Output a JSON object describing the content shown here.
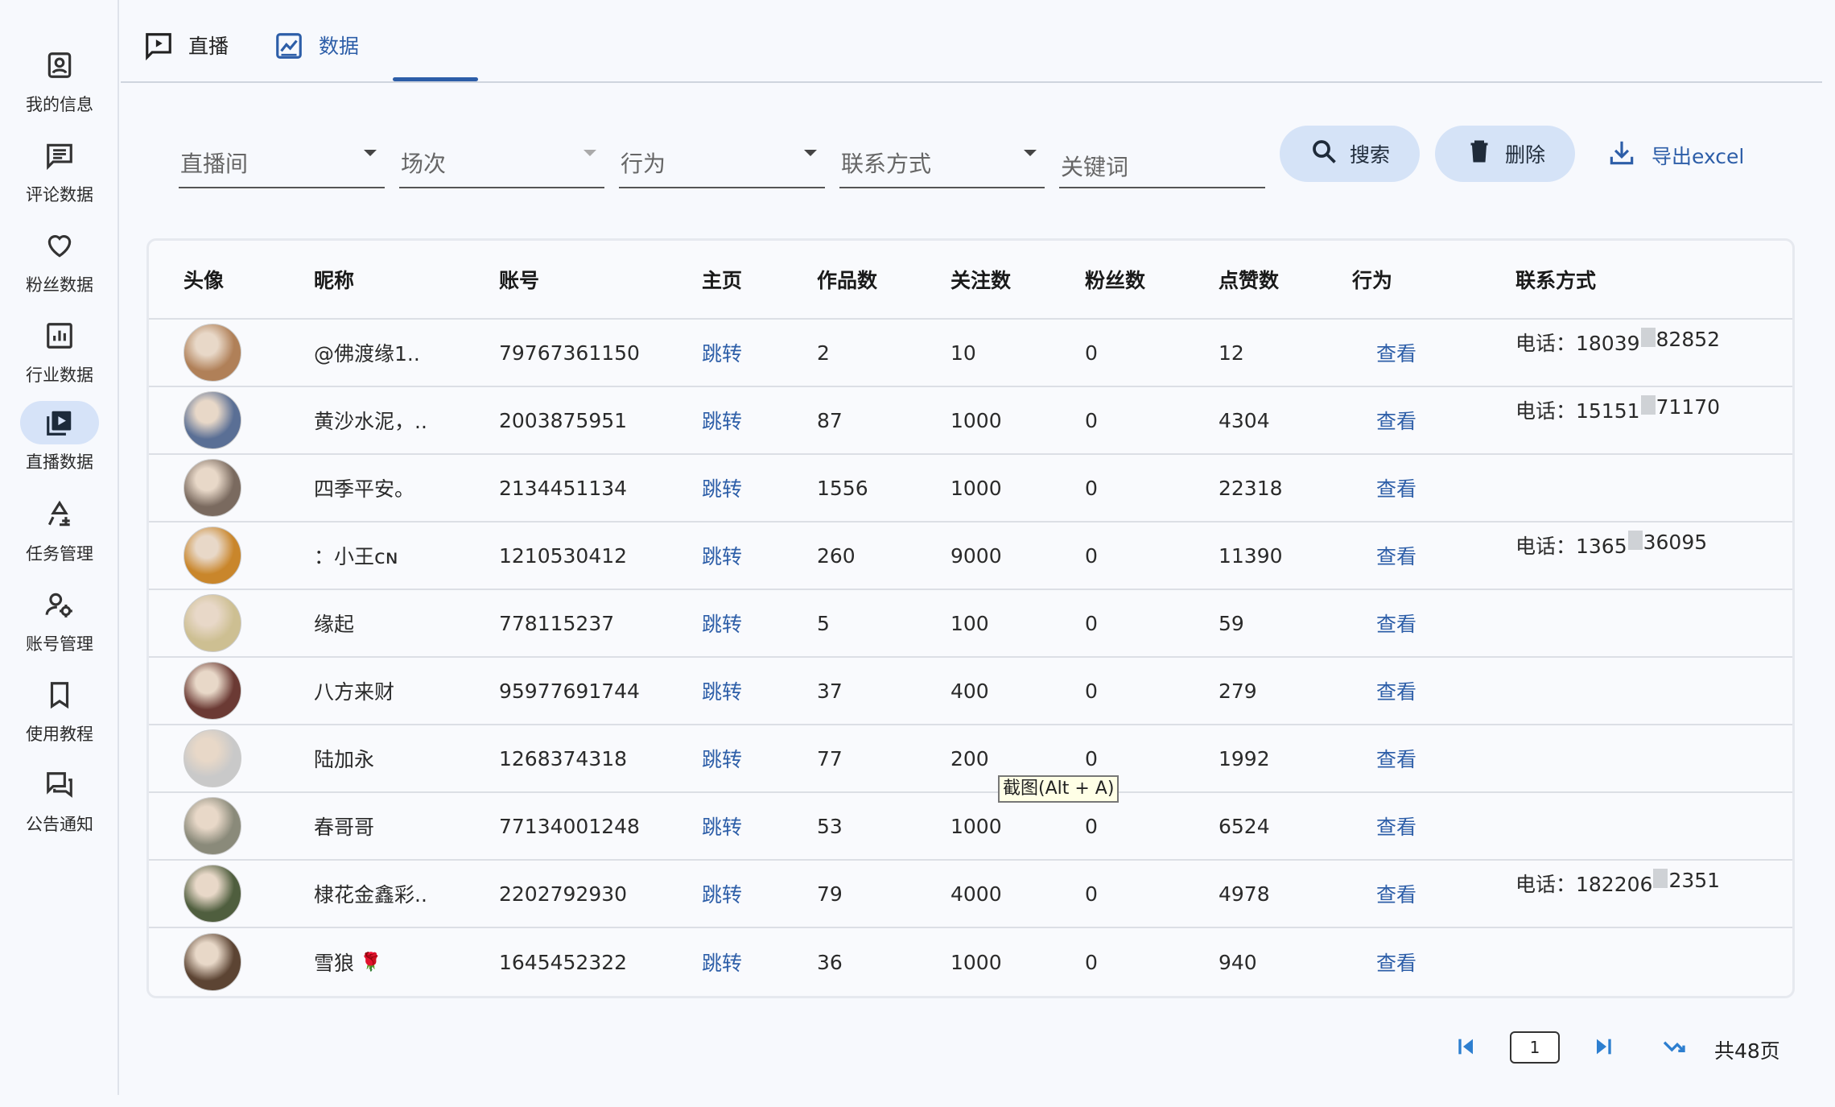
{
  "colors": {
    "accent": "#2d5ea8",
    "active_bg": "#d6e3f8",
    "button_bg": "#d5e3f7"
  },
  "sidebar": {
    "items": [
      {
        "label": "我的信息",
        "icon": "account-box-icon",
        "active": false
      },
      {
        "label": "评论数据",
        "icon": "comment-icon",
        "active": false
      },
      {
        "label": "粉丝数据",
        "icon": "heart-icon",
        "active": false
      },
      {
        "label": "行业数据",
        "icon": "bar-chart-icon",
        "active": false
      },
      {
        "label": "直播数据",
        "icon": "video-library-icon",
        "active": true
      },
      {
        "label": "任务管理",
        "icon": "task-recycle-icon",
        "active": false
      },
      {
        "label": "账号管理",
        "icon": "user-cog-icon",
        "active": false
      },
      {
        "label": "使用教程",
        "icon": "bookmark-icon",
        "active": false
      },
      {
        "label": "公告通知",
        "icon": "forum-icon",
        "active": false
      }
    ]
  },
  "tabs": [
    {
      "label": "直播",
      "icon": "live-chat-icon",
      "active": false
    },
    {
      "label": "数据",
      "icon": "chart-icon",
      "active": true
    }
  ],
  "filters": {
    "live_room": "直播间",
    "session": "场次",
    "behavior": "行为",
    "contact": "联系方式",
    "keyword": "关键词"
  },
  "actions": {
    "search": "搜索",
    "delete": "删除",
    "export": "导出excel"
  },
  "table": {
    "headers": [
      "头像",
      "昵称",
      "账号",
      "主页",
      "作品数",
      "关注数",
      "粉丝数",
      "点赞数",
      "行为",
      "联系方式"
    ],
    "rows": [
      {
        "nickname": "@佛渡缘1..",
        "account": "79767361150",
        "home": "跳转",
        "works": "2",
        "following": "10",
        "fans": "0",
        "likes": "12",
        "behavior": "查看",
        "contact_prefix": "电话：18039",
        "contact_suffix": "82852",
        "avatar_color": "#b08058"
      },
      {
        "nickname": "黄沙水泥，..",
        "account": "2003875951",
        "home": "跳转",
        "works": "87",
        "following": "1000",
        "fans": "0",
        "likes": "4304",
        "behavior": "查看",
        "contact_prefix": "电话：15151",
        "contact_suffix": "71170",
        "avatar_color": "#5a6f95"
      },
      {
        "nickname": "四季平安。",
        "account": "2134451134",
        "home": "跳转",
        "works": "1556",
        "following": "1000",
        "fans": "0",
        "likes": "22318",
        "behavior": "查看",
        "contact_prefix": "",
        "contact_suffix": "",
        "avatar_color": "#7a6a5f"
      },
      {
        "nickname": "：小王ᴄɴ",
        "account": "1210530412",
        "home": "跳转",
        "works": "260",
        "following": "9000",
        "fans": "0",
        "likes": "11390",
        "behavior": "查看",
        "contact_prefix": "电话：1365",
        "contact_suffix": "36095",
        "avatar_color": "#c9862b"
      },
      {
        "nickname": "缘起",
        "account": "778115237",
        "home": "跳转",
        "works": "5",
        "following": "100",
        "fans": "0",
        "likes": "59",
        "behavior": "查看",
        "contact_prefix": "",
        "contact_suffix": "",
        "avatar_color": "#cdbf92"
      },
      {
        "nickname": "八方来财",
        "account": "95977691744",
        "home": "跳转",
        "works": "37",
        "following": "400",
        "fans": "0",
        "likes": "279",
        "behavior": "查看",
        "contact_prefix": "",
        "contact_suffix": "",
        "avatar_color": "#6b3a34"
      },
      {
        "nickname": "陆加永",
        "account": "1268374318",
        "home": "跳转",
        "works": "77",
        "following": "200",
        "fans": "0",
        "likes": "1992",
        "behavior": "查看",
        "contact_prefix": "",
        "contact_suffix": "",
        "avatar_color": "#c9c9c9"
      },
      {
        "nickname": "春哥哥",
        "account": "77134001248",
        "home": "跳转",
        "works": "53",
        "following": "1000",
        "fans": "0",
        "likes": "6524",
        "behavior": "查看",
        "contact_prefix": "",
        "contact_suffix": "",
        "avatar_color": "#8a8a7a"
      },
      {
        "nickname": "棣花金鑫彩..",
        "account": "2202792930",
        "home": "跳转",
        "works": "79",
        "following": "4000",
        "fans": "0",
        "likes": "4978",
        "behavior": "查看",
        "contact_prefix": "电话：182206",
        "contact_suffix": "2351",
        "avatar_color": "#4f5e3e"
      },
      {
        "nickname": "雪狼",
        "account": "1645452322",
        "home": "跳转",
        "works": "36",
        "following": "1000",
        "fans": "0",
        "likes": "940",
        "behavior": "查看",
        "contact_prefix": "",
        "contact_suffix": "",
        "avatar_color": "#5c4433",
        "emoji": "🌹"
      }
    ]
  },
  "tooltip": "截图(Alt + A)",
  "pagination": {
    "current": "1",
    "total": "共48页"
  }
}
